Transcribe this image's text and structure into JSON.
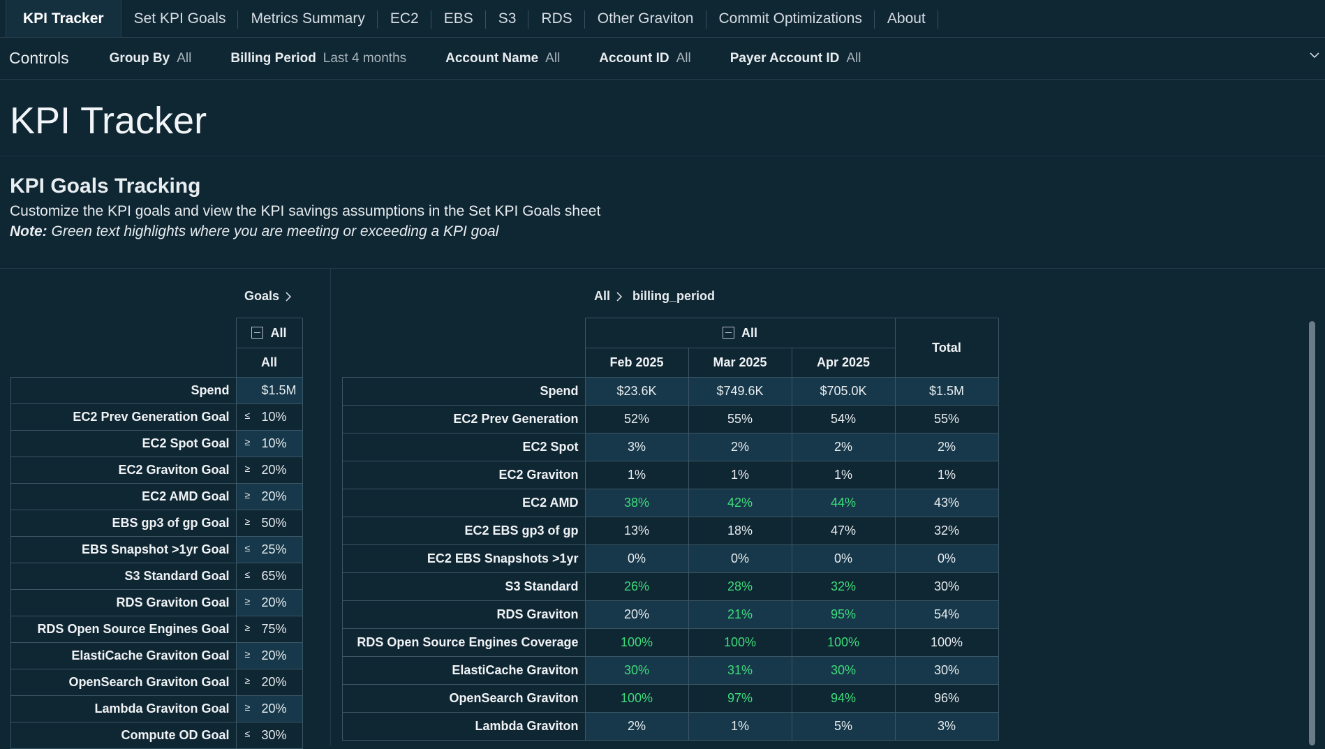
{
  "tabs": [
    "KPI Tracker",
    "Set KPI Goals",
    "Metrics Summary",
    "EC2",
    "EBS",
    "S3",
    "RDS",
    "Other Graviton",
    "Commit Optimizations",
    "About"
  ],
  "controls": {
    "title": "Controls",
    "filters": [
      {
        "label": "Group By",
        "value": "All"
      },
      {
        "label": "Billing Period",
        "value": "Last 4 months"
      },
      {
        "label": "Account Name",
        "value": "All"
      },
      {
        "label": "Account ID",
        "value": "All"
      },
      {
        "label": "Payer Account ID",
        "value": "All"
      }
    ],
    "expand_icon": "chevron-down-icon"
  },
  "page_title": "KPI Tracker",
  "section": {
    "title": "KPI Goals Tracking",
    "description": "Customize the KPI goals and view the KPI savings assumptions in the Set KPI Goals sheet",
    "note_label": "Note:",
    "note_text": " Green text highlights where you are meeting or exceeding a KPI goal"
  },
  "colors": {
    "background": "#0f2633",
    "meets_goal": "#3ddc7a",
    "row_shade": "#17384a"
  },
  "goals_table": {
    "breadcrumb": "Goals",
    "group_header": "All",
    "column_header": "All",
    "rows": [
      {
        "label": "Spend",
        "symbol": "",
        "value": "$1.5M"
      },
      {
        "label": "EC2 Prev Generation Goal",
        "symbol": "≤",
        "value": "10%"
      },
      {
        "label": "EC2 Spot Goal",
        "symbol": "≥",
        "value": "10%"
      },
      {
        "label": "EC2 Graviton Goal",
        "symbol": "≥",
        "value": "20%"
      },
      {
        "label": "EC2 AMD Goal",
        "symbol": "≥",
        "value": "20%"
      },
      {
        "label": "EBS gp3 of gp Goal",
        "symbol": "≥",
        "value": "50%"
      },
      {
        "label": "EBS Snapshot >1yr Goal",
        "symbol": "≤",
        "value": "25%"
      },
      {
        "label": "S3 Standard Goal",
        "symbol": "≤",
        "value": "65%"
      },
      {
        "label": "RDS Graviton Goal",
        "symbol": "≥",
        "value": "20%"
      },
      {
        "label": "RDS Open Source Engines Goal",
        "symbol": "≥",
        "value": "75%"
      },
      {
        "label": "ElastiCache Graviton Goal",
        "symbol": "≥",
        "value": "20%"
      },
      {
        "label": "OpenSearch Graviton Goal",
        "symbol": "≥",
        "value": "20%"
      },
      {
        "label": "Lambda Graviton Goal",
        "symbol": "≥",
        "value": "20%"
      },
      {
        "label": "Compute OD Goal",
        "symbol": "≤",
        "value": "30%"
      }
    ]
  },
  "metrics_table": {
    "breadcrumb": {
      "root": "All",
      "leaf": "billing_period"
    },
    "group_header": "All",
    "columns": [
      "Feb 2025",
      "Mar 2025",
      "Apr 2025"
    ],
    "total_header": "Total",
    "rows": [
      {
        "label": "Spend",
        "values": [
          "$23.6K",
          "$749.6K",
          "$705.0K"
        ],
        "total": "$1.5M",
        "green": [
          false,
          false,
          false
        ]
      },
      {
        "label": "EC2 Prev Generation",
        "values": [
          "52%",
          "55%",
          "54%"
        ],
        "total": "55%",
        "green": [
          false,
          false,
          false
        ]
      },
      {
        "label": "EC2 Spot",
        "values": [
          "3%",
          "2%",
          "2%"
        ],
        "total": "2%",
        "green": [
          false,
          false,
          false
        ]
      },
      {
        "label": "EC2 Graviton",
        "values": [
          "1%",
          "1%",
          "1%"
        ],
        "total": "1%",
        "green": [
          false,
          false,
          false
        ]
      },
      {
        "label": "EC2 AMD",
        "values": [
          "38%",
          "42%",
          "44%"
        ],
        "total": "43%",
        "green": [
          true,
          true,
          true
        ]
      },
      {
        "label": "EC2 EBS gp3 of gp",
        "values": [
          "13%",
          "18%",
          "47%"
        ],
        "total": "32%",
        "green": [
          false,
          false,
          false
        ]
      },
      {
        "label": "EC2 EBS Snapshots >1yr",
        "values": [
          "0%",
          "0%",
          "0%"
        ],
        "total": "0%",
        "green": [
          false,
          false,
          false
        ]
      },
      {
        "label": "S3 Standard",
        "values": [
          "26%",
          "28%",
          "32%"
        ],
        "total": "30%",
        "green": [
          true,
          true,
          true
        ]
      },
      {
        "label": "RDS Graviton",
        "values": [
          "20%",
          "21%",
          "95%"
        ],
        "total": "54%",
        "green": [
          false,
          true,
          true
        ]
      },
      {
        "label": "RDS Open Source Engines Coverage",
        "values": [
          "100%",
          "100%",
          "100%"
        ],
        "total": "100%",
        "green": [
          true,
          true,
          true
        ]
      },
      {
        "label": "ElastiCache Graviton",
        "values": [
          "30%",
          "31%",
          "30%"
        ],
        "total": "30%",
        "green": [
          true,
          true,
          true
        ]
      },
      {
        "label": "OpenSearch Graviton",
        "values": [
          "100%",
          "97%",
          "94%"
        ],
        "total": "96%",
        "green": [
          true,
          true,
          true
        ]
      },
      {
        "label": "Lambda Graviton",
        "values": [
          "2%",
          "1%",
          "5%"
        ],
        "total": "3%",
        "green": [
          false,
          false,
          false
        ]
      }
    ]
  }
}
